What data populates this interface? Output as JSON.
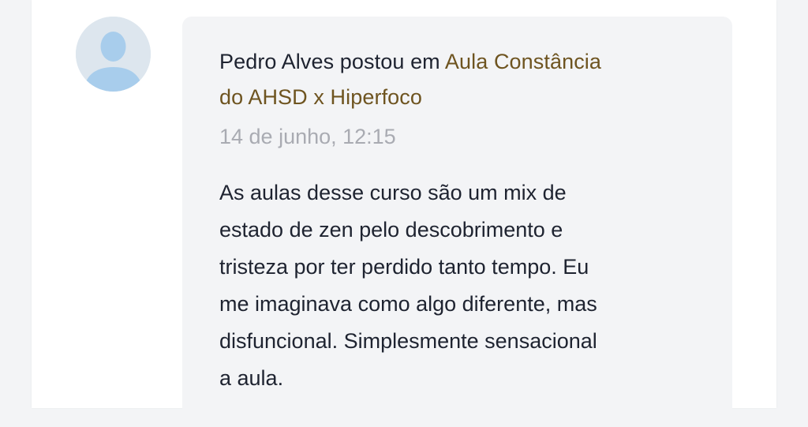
{
  "post": {
    "author": "Pedro Alves",
    "action": "postou em",
    "topic_line1": "Aula Constância",
    "topic_line2": "do AHSD x Hiperfoco",
    "timestamp": "14 de junho, 12:15",
    "message_lines": [
      "As aulas desse curso são um mix de",
      "estado de zen pelo descobrimento e",
      "tristeza por ter perdido tanto tempo. Eu",
      "me imaginava como algo diferente, mas",
      "disfuncional. Simplesmente sensacional",
      "a aula."
    ]
  },
  "avatar": {
    "icon": "user-silhouette-icon"
  },
  "colors": {
    "text": "#1e2330",
    "link": "#6e5420",
    "muted": "#a9abb2",
    "bubble": "#f3f4f6",
    "avatar_bg": "#dde6ee",
    "avatar_figure": "#a8cdec"
  }
}
